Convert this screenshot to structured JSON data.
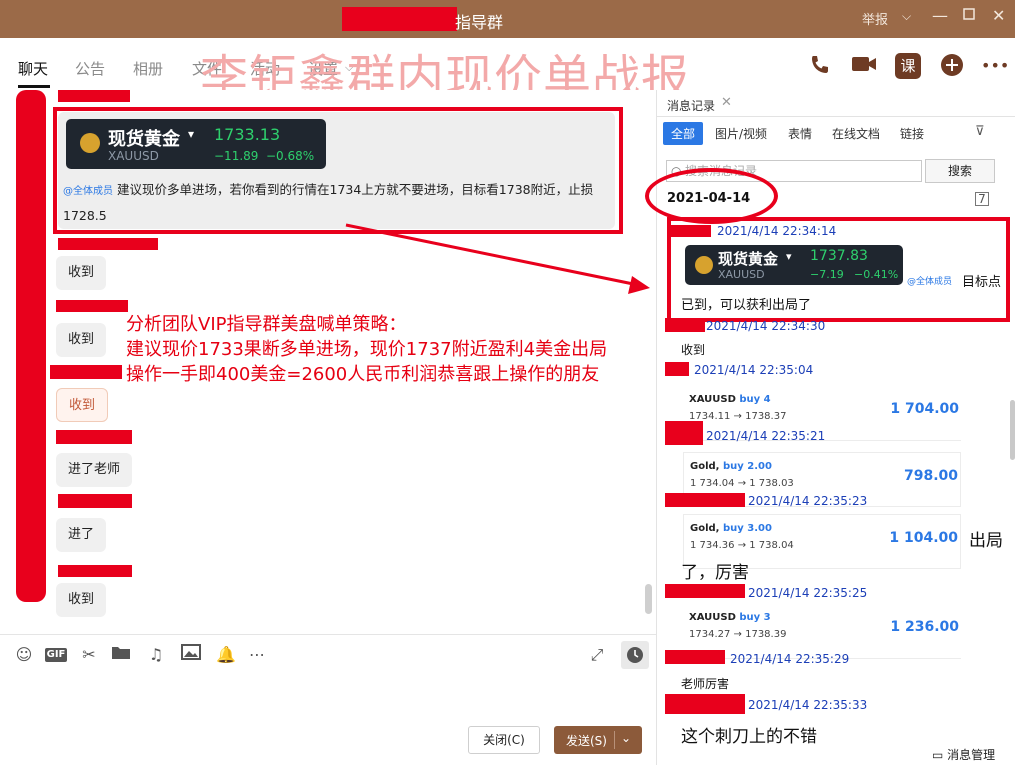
{
  "window": {
    "title": "指导群",
    "report": "举报"
  },
  "tabs": [
    "聊天",
    "公告",
    "相册",
    "文件",
    "活动",
    "设置"
  ],
  "overlay_title": "李钜鑫群内现价单战报",
  "top_icons": {
    "lesson": "课"
  },
  "chat": {
    "quote": {
      "name": "现货黄金",
      "symbol": "XAUUSD",
      "price": "1733.13",
      "change": "−11.89",
      "change_pct": "−0.68%",
      "mention": "@全体成员",
      "text": "建议现价多单进场，若你看到的行情在1734上方就不要进场，目标看1738附近，止损1728.5"
    },
    "bubbles": [
      "收到",
      "收到",
      "收到",
      "进了老师",
      "进了",
      "收到"
    ],
    "annotation": [
      "分析团队VIP指导群美盘喊单策略：",
      "建议现价1733果断多单进场，现价1737附近盈利4美金出局",
      "操作一手即400美金=2600人民币利润恭喜跟上操作的朋友"
    ]
  },
  "input": {
    "close_label": "关闭(C)",
    "send_label": "发送(S)"
  },
  "right_panel": {
    "header": "消息记录",
    "tabs": [
      "全部",
      "图片/视频",
      "表情",
      "在线文档",
      "链接"
    ],
    "search_placeholder": "搜索消息记录",
    "search_btn": "搜索",
    "date": "2021-04-14",
    "first_ts": "2021/4/14 22:34:14",
    "quote": {
      "name": "现货黄金",
      "symbol": "XAUUSD",
      "price": "1737.83",
      "change": "−7.19",
      "change_pct": "−0.41%",
      "mention": "@全体成员",
      "target": "目标点",
      "reply": "已到，可以获利出局了"
    },
    "entries": [
      {
        "ts": "2021/4/14 22:34:30",
        "text": "收到"
      },
      {
        "ts": "2021/4/14 22:35:04"
      },
      {
        "ts": "2021/4/14 22:35:21"
      },
      {
        "ts": "2021/4/14 22:35:23",
        "text_a": "出局",
        "text_b": "了，厉害"
      },
      {
        "ts": "2021/4/14 22:35:25"
      },
      {
        "ts": "2021/4/14 22:35:29",
        "text": "老师厉害"
      },
      {
        "ts": "2021/4/14 22:35:33",
        "text": "这个刺刀上的不错"
      }
    ],
    "trades": [
      {
        "pair": "XAUUSD",
        "side": "buy 4",
        "range": "1734.11 → 1738.37",
        "amount": "1 704.00"
      },
      {
        "pair": "Gold,",
        "side": "buy 2.00",
        "range": "1 734.04 → 1 738.03",
        "amount": "798.00"
      },
      {
        "pair": "Gold,",
        "side": "buy 3.00",
        "range": "1 734.36 → 1 738.04",
        "amount": "1 104.00"
      },
      {
        "pair": "XAUUSD",
        "side": "buy 3",
        "range": "1734.27 → 1738.39",
        "amount": "1 236.00"
      }
    ],
    "footer": "消息管理"
  }
}
